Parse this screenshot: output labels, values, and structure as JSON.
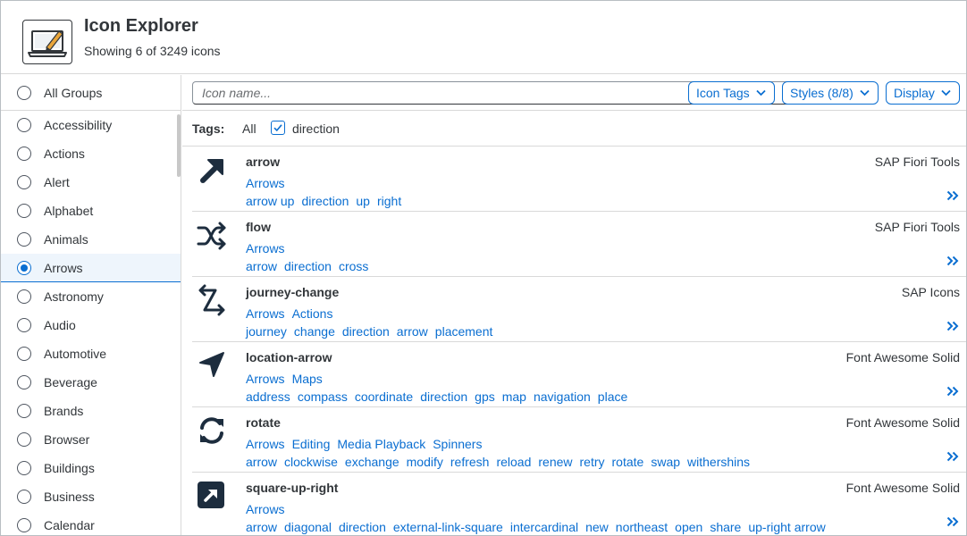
{
  "header": {
    "title": "Icon Explorer",
    "subtitle": "Showing 6 of 3249 icons",
    "app_icon": "laptop-pencil-icon"
  },
  "sidebar": {
    "all_groups_label": "All Groups",
    "selected_group": "Arrows",
    "groups": [
      "Accessibility",
      "Actions",
      "Alert",
      "Alphabet",
      "Animals",
      "Arrows",
      "Astronomy",
      "Audio",
      "Automotive",
      "Beverage",
      "Brands",
      "Browser",
      "Buildings",
      "Business",
      "Calendar"
    ]
  },
  "toolbar": {
    "search_placeholder": "Icon name...",
    "search_value": "",
    "icon_tags_label": "Icon Tags",
    "styles_label": "Styles (8/8)",
    "display_label": "Display"
  },
  "tags_bar": {
    "label": "Tags:",
    "all_label": "All",
    "checked_tag": "direction",
    "checked": true
  },
  "results": [
    {
      "name": "arrow",
      "source": "SAP Fiori Tools",
      "icon": "arrow-up-right-icon",
      "groups": [
        "Arrows"
      ],
      "tags": [
        "arrow up",
        "direction",
        "up",
        "right"
      ]
    },
    {
      "name": "flow",
      "source": "SAP Fiori Tools",
      "icon": "shuffle-icon",
      "groups": [
        "Arrows"
      ],
      "tags": [
        "arrow",
        "direction",
        "cross"
      ]
    },
    {
      "name": "journey-change",
      "source": "SAP Icons",
      "icon": "journey-change-icon",
      "groups": [
        "Arrows",
        "Actions"
      ],
      "tags": [
        "journey",
        "change",
        "direction",
        "arrow",
        "placement"
      ]
    },
    {
      "name": "location-arrow",
      "source": "Font Awesome Solid",
      "icon": "location-arrow-icon",
      "groups": [
        "Arrows",
        "Maps"
      ],
      "tags": [
        "address",
        "compass",
        "coordinate",
        "direction",
        "gps",
        "map",
        "navigation",
        "place"
      ]
    },
    {
      "name": "rotate",
      "source": "Font Awesome Solid",
      "icon": "rotate-icon",
      "groups": [
        "Arrows",
        "Editing",
        "Media Playback",
        "Spinners"
      ],
      "tags": [
        "arrow",
        "clockwise",
        "exchange",
        "modify",
        "refresh",
        "reload",
        "renew",
        "retry",
        "rotate",
        "swap",
        "withershins"
      ]
    },
    {
      "name": "square-up-right",
      "source": "Font Awesome Solid",
      "icon": "square-up-right-icon",
      "groups": [
        "Arrows"
      ],
      "tags": [
        "arrow",
        "diagonal",
        "direction",
        "external-link-square",
        "intercardinal",
        "new",
        "northeast",
        "open",
        "share",
        "up-right arrow"
      ]
    }
  ],
  "colors": {
    "accent": "#0a6ed1",
    "text": "#32363a",
    "border": "#d9d9d9",
    "selected_bg": "#eef5fc"
  }
}
